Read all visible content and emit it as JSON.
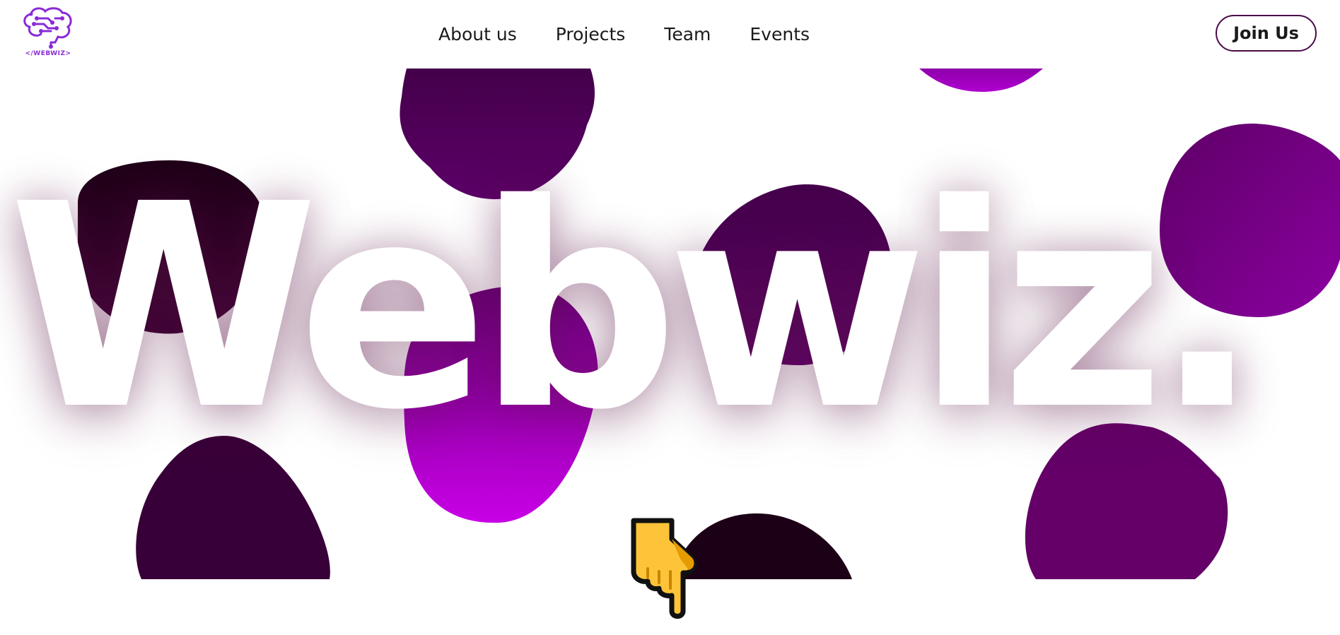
{
  "header": {
    "logo_text": "</WEBWIZ>",
    "nav": [
      {
        "label": "About us"
      },
      {
        "label": "Projects"
      },
      {
        "label": "Team"
      },
      {
        "label": "Events"
      }
    ],
    "join_label": "Join Us"
  },
  "hero": {
    "title": "Webwiz."
  },
  "colors": {
    "brand_purple": "#8a2bd6",
    "button_border": "#4a0a48",
    "blob_dark": "#2a0022",
    "blob_plum": "#54005a",
    "blob_magenta": "#b400d8",
    "blob_violet": "#7a0090"
  },
  "icons": {
    "logo": "brain-circuit-icon",
    "scroll_hint": "hand-pointing-down-icon"
  }
}
